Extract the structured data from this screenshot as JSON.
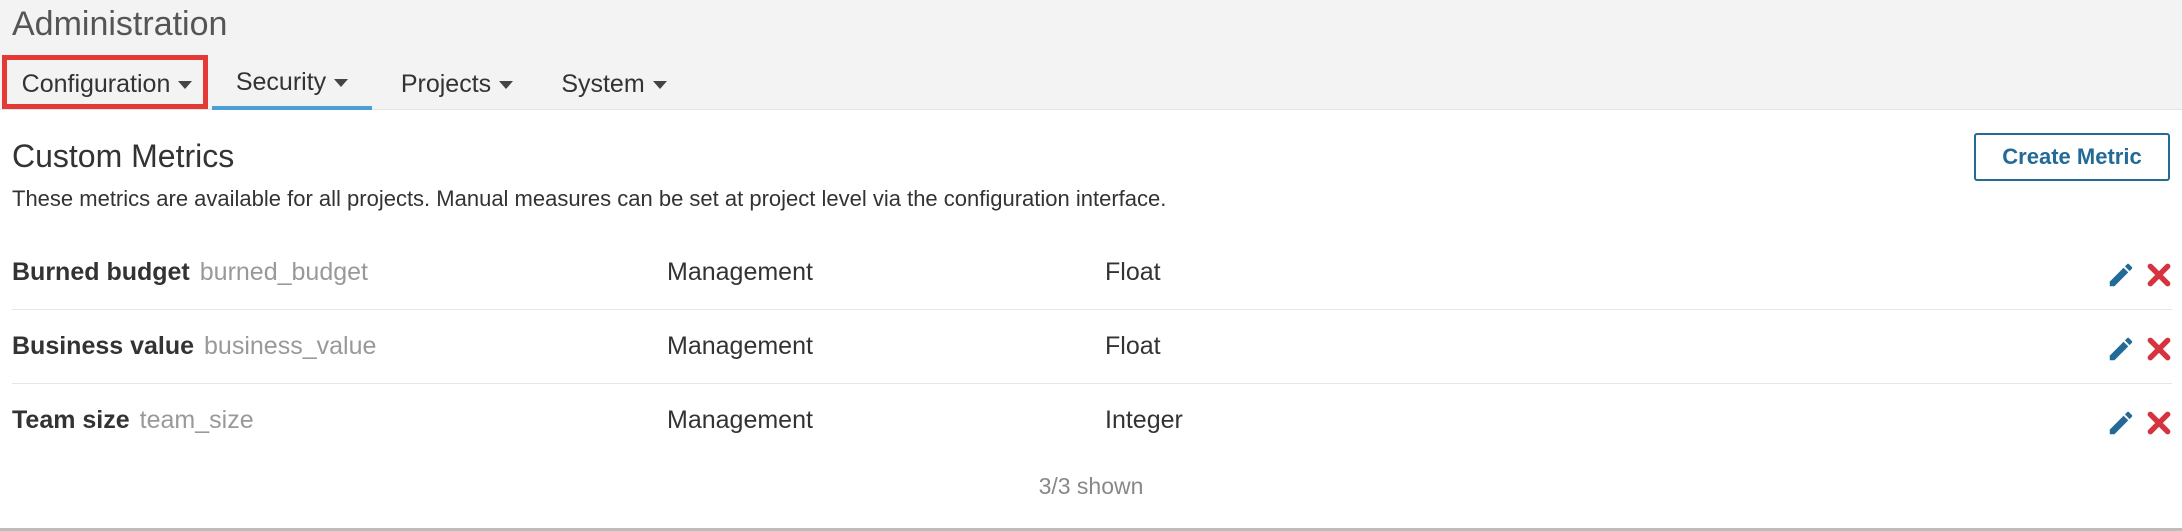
{
  "page": {
    "title": "Administration"
  },
  "nav": {
    "tabs": [
      {
        "label": "Configuration",
        "active": false,
        "focused": true
      },
      {
        "label": "Security",
        "active": true,
        "focused": false
      },
      {
        "label": "Projects",
        "active": false,
        "focused": false
      },
      {
        "label": "System",
        "active": false,
        "focused": false
      }
    ]
  },
  "section": {
    "title": "Custom Metrics",
    "description": "These metrics are available for all projects. Manual measures can be set at project level via the configuration interface.",
    "create_button_label": "Create Metric"
  },
  "metrics": {
    "rows": [
      {
        "name": "Burned budget",
        "key": "burned_budget",
        "domain": "Management",
        "type": "Float"
      },
      {
        "name": "Business value",
        "key": "business_value",
        "domain": "Management",
        "type": "Float"
      },
      {
        "name": "Team size",
        "key": "team_size",
        "domain": "Management",
        "type": "Integer"
      }
    ],
    "shown_text": "3/3 shown"
  },
  "icons": {
    "caret": "caret-down-icon",
    "edit": "pencil-icon",
    "delete": "close-icon"
  },
  "colors": {
    "accent": "#236a97",
    "active_tab_underline": "#4b9fd5",
    "focus_outline": "#e53935",
    "delete_icon": "#d4333f",
    "edit_icon": "#236a97",
    "header_background": "#f3f3f3"
  }
}
